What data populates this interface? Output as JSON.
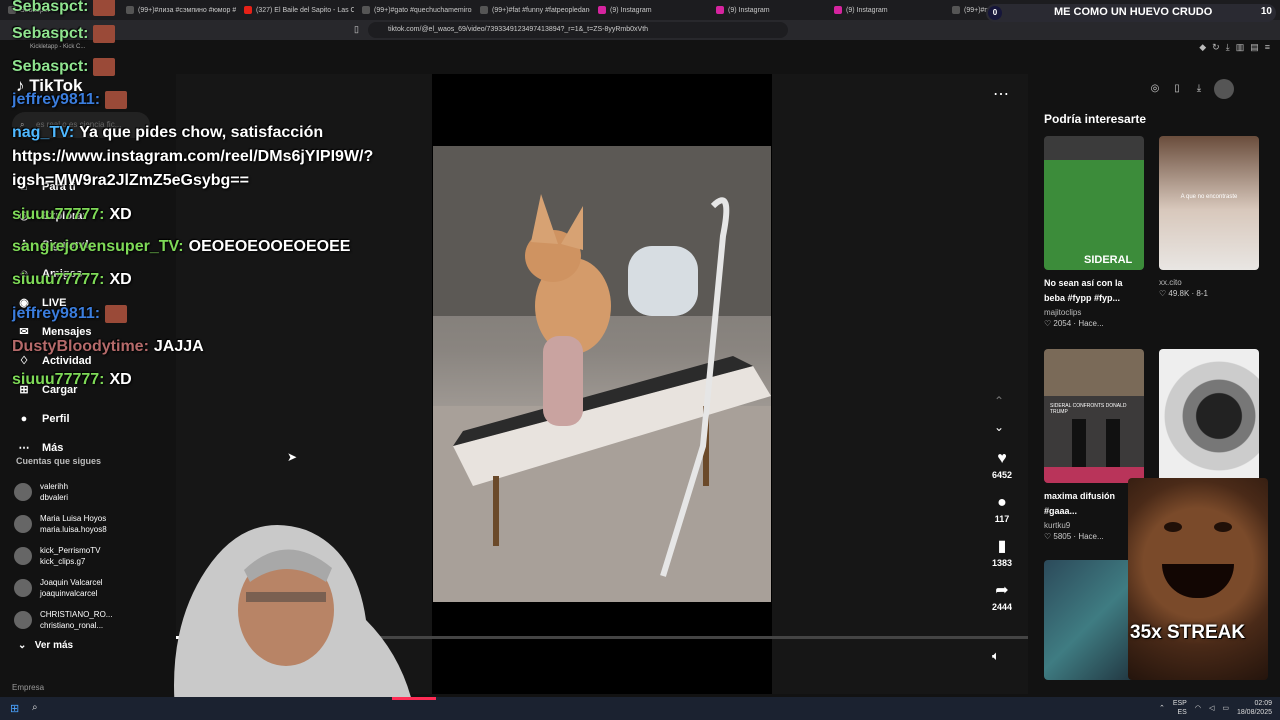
{
  "browser": {
    "tabs": [
      {
        "label": "Sebaspct",
        "kind": "generic"
      },
      {
        "label": "(99+)#лиза #сэмпино #юмор #fyp",
        "kind": "generic"
      },
      {
        "label": "(327) El Baile del Sapito - Las Cana",
        "kind": "yt"
      },
      {
        "label": "(99+)#gato #quechuchamemiros",
        "kind": "generic"
      },
      {
        "label": "(99+)#fat #funny #fatpeopledanc",
        "kind": "generic"
      },
      {
        "label": "(9) Instagram",
        "kind": "ig"
      },
      {
        "label": "(9) Instagram",
        "kind": "ig"
      },
      {
        "label": "(9) Instagram",
        "kind": "ig"
      },
      {
        "label": "(99+)#m mascotas | TikTo",
        "kind": "generic"
      }
    ],
    "url": "tiktok.com/@el_waos_69/video/7393349123497413894?_r=1&_t=ZS-8yyRmb0xVth",
    "bookmark": "Kickletapp - Kick C..."
  },
  "stream": {
    "counter_left": "0",
    "title": "ME COMO UN HUEVO CRUDO",
    "counter_right": "10",
    "streak": "35x STREAK"
  },
  "tiktok": {
    "logo": "TikTok",
    "search_placeholder": "es real o es ciencia fic...",
    "nav": [
      {
        "label": "Para ti",
        "icon": "home-icon"
      },
      {
        "label": "Explorar",
        "icon": "compass-icon"
      },
      {
        "label": "Siguiendo",
        "icon": "following-icon"
      },
      {
        "label": "Amigos",
        "icon": "friends-icon"
      },
      {
        "label": "LIVE",
        "icon": "live-icon"
      },
      {
        "label": "Mensajes",
        "icon": "messages-icon"
      },
      {
        "label": "Actividad",
        "icon": "activity-icon"
      },
      {
        "label": "Cargar",
        "icon": "upload-icon"
      },
      {
        "label": "Perfil",
        "icon": "profile-icon"
      },
      {
        "label": "Más",
        "icon": "more-icon"
      }
    ],
    "following_title": "Cuentas que sigues",
    "following": [
      {
        "name": "valerihh",
        "handle": "dbvaleri"
      },
      {
        "name": "Maria Luisa Hoyos",
        "handle": "maria.luisa.hoyos8"
      },
      {
        "name": "kick_PerrismoTV",
        "handle": "kick_clips.g7"
      },
      {
        "name": "Joaquin Valcarcel",
        "handle": "joaquinvalcarcel"
      },
      {
        "name": "CHRISTIANO_RO...",
        "handle": "christiano_ronal..."
      }
    ],
    "see_more": "Ver más",
    "company": "Empresa",
    "video": {
      "likes": "6452",
      "comments": "117",
      "saves": "1383",
      "shares": "2444",
      "progress": 0.21
    },
    "recommend_title": "Podría interesarte",
    "recommended": [
      {
        "title": "No sean así con la beba #fypp #fyp...",
        "author": "majitoclips",
        "meta": "2054 · Hace...",
        "thumb_text": "SIDERAL"
      },
      {
        "title": "",
        "author": "xx.cito",
        "meta": "49.8K · 8-1",
        "thumb_text": "A que no encontraste"
      },
      {
        "title": "maxima difusión #gaaa...",
        "author": "kurtku9",
        "meta": "5805 · Hace...",
        "thumb_text": "SIDERAL CONFRONTS DONALD TRUMP"
      },
      {
        "title": "",
        "author": "",
        "meta": "",
        "thumb_text": ""
      }
    ]
  },
  "chat": [
    {
      "user": "Sebaspct:",
      "text": "",
      "color": "#8fe38f",
      "emote": true
    },
    {
      "user": "Sebaspct:",
      "text": "",
      "color": "#8fe38f",
      "emote": true
    },
    {
      "user": "Sebaspct:",
      "text": "",
      "color": "#8fe38f",
      "emote": true
    },
    {
      "user": "jeffrey9811:",
      "text": "",
      "color": "#3b7ddd",
      "emote": true
    },
    {
      "user": "nag_TV:",
      "text": "Ya que pides chow, satisfacción",
      "color": "#4fb8ff",
      "emote": false
    },
    {
      "user": "",
      "text": "https://www.instagram.com/reel/DMs6jYIPI9W/?",
      "color": "#fff",
      "emote": false
    },
    {
      "user": "",
      "text": "igsh=MW9ra2JlZmZ5eGsybg==",
      "color": "#fff",
      "emote": false
    },
    {
      "user": "siuuu77777:",
      "text": "XD",
      "color": "#7ed957",
      "emote": false
    },
    {
      "user": "sangrejovensuper_TV:",
      "text": "OEOEOEOOEOEOEE",
      "color": "#7ed957",
      "emote": false
    },
    {
      "user": "siuuu77777:",
      "text": "XD",
      "color": "#7ed957",
      "emote": false
    },
    {
      "user": "jeffrey9811:",
      "text": "",
      "color": "#3b7ddd",
      "emote": true
    },
    {
      "user": "DustyBloodytime:",
      "text": "JAJJA",
      "color": "#b56a6a",
      "emote": false
    },
    {
      "user": "siuuu77777:",
      "text": "XD",
      "color": "#7ed957",
      "emote": false
    }
  ],
  "taskbar": {
    "lang_top": "ESP",
    "lang_bottom": "ES",
    "time": "02:09",
    "date": "18/08/2025"
  }
}
